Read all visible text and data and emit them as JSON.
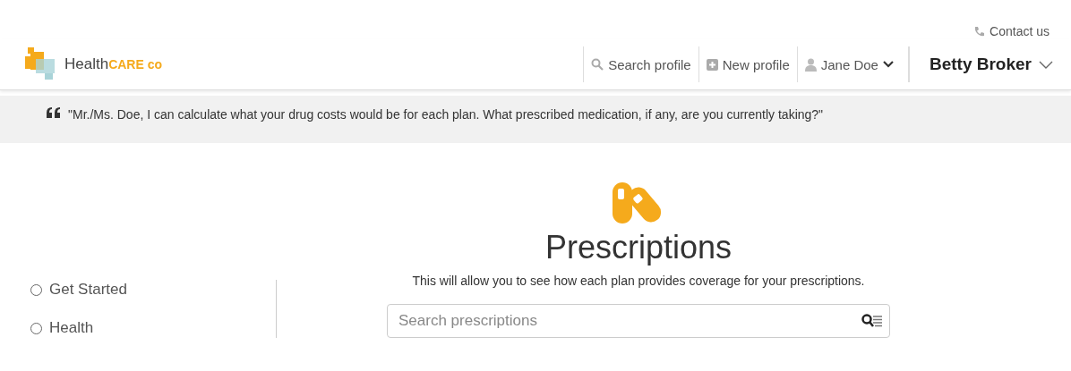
{
  "header": {
    "contact_link": "Contact us",
    "brand": {
      "name": "Health",
      "accent": "CARE co"
    },
    "nav": [
      {
        "kind": "search",
        "label": "Search profile"
      },
      {
        "kind": "add",
        "label": "New profile"
      },
      {
        "kind": "profile",
        "label": "Jane Doe"
      }
    ],
    "user_menu": {
      "label": "Betty Broker"
    }
  },
  "script_banner": {
    "text": "\"Mr./Ms. Doe, I can calculate what your drug costs would be for each plan. What prescribed medication, if any, are you currently taking?\""
  },
  "sidebar": {
    "items": [
      {
        "label": "Get Started",
        "selected": false
      },
      {
        "label": "Health",
        "selected": false
      }
    ]
  },
  "main": {
    "title": "Prescriptions",
    "subtitle": "This will allow you to see how each plan provides coverage for your prescriptions.",
    "search": {
      "placeholder": "Search prescriptions"
    }
  }
}
